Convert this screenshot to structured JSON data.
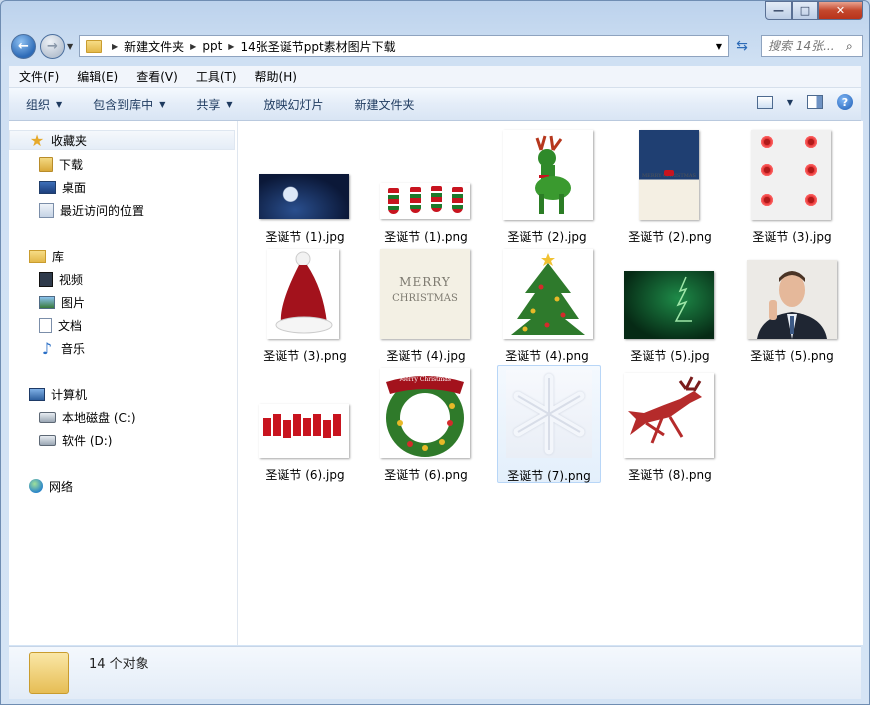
{
  "window": {
    "caption_buttons": [
      "minimize",
      "maximize",
      "close"
    ]
  },
  "address": {
    "crumbs": [
      "新建文件夹",
      "ppt",
      "14张圣诞节ppt素材图片下载"
    ]
  },
  "search": {
    "placeholder": "搜索 14张..."
  },
  "menu": [
    "文件(F)",
    "编辑(E)",
    "查看(V)",
    "工具(T)",
    "帮助(H)"
  ],
  "commands": {
    "organize": "组织",
    "include": "包含到库中",
    "share": "共享",
    "slideshow": "放映幻灯片",
    "new_folder": "新建文件夹"
  },
  "nav": {
    "favorites": "收藏夹",
    "downloads": "下载",
    "desktop": "桌面",
    "recent": "最近访问的位置",
    "libraries": "库",
    "videos": "视频",
    "pictures": "图片",
    "documents": "文档",
    "music": "音乐",
    "computer": "计算机",
    "drive_c": "本地磁盘 (C:)",
    "drive_d": "软件 (D:)",
    "network": "网络"
  },
  "files": [
    "圣诞节 (1).jpg",
    "圣诞节 (1).png",
    "圣诞节 (2).jpg",
    "圣诞节 (2).png",
    "圣诞节 (3).jpg",
    "圣诞节 (3).png",
    "圣诞节 (4).jpg",
    "圣诞节 (4).png",
    "圣诞节 (5).jpg",
    "圣诞节 (5).png",
    "圣诞节 (6).jpg",
    "圣诞节 (6).png",
    "圣诞节 (7).png",
    "圣诞节 (8).png"
  ],
  "thumb_text": {
    "card_title": "MERRY CHRISTMAS",
    "merry": "MERRY",
    "christmas": "CHRISTMAS",
    "wreath_banner": "Merry Christmas"
  },
  "selected_file": "圣诞节 (7).png",
  "status": {
    "count": "14 个对象"
  }
}
